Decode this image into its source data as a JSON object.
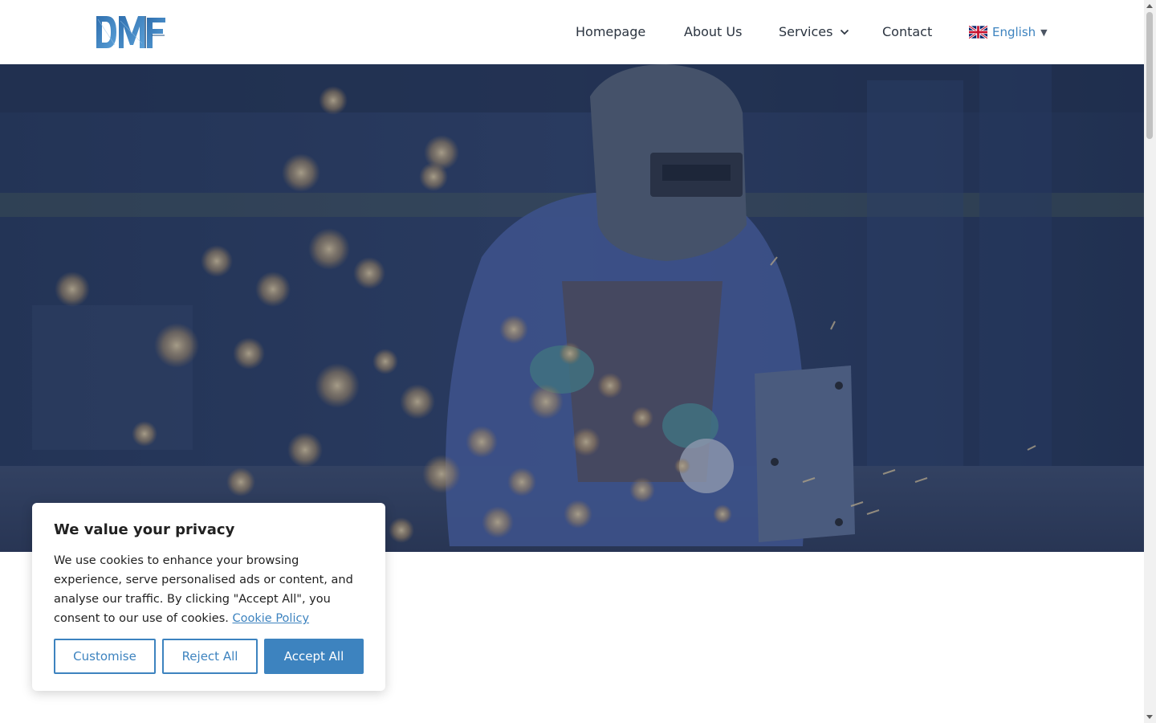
{
  "header": {
    "logo_alt": "DMF",
    "nav": [
      {
        "label": "Homepage"
      },
      {
        "label": "About Us"
      },
      {
        "label": "Services"
      },
      {
        "label": "Contact"
      }
    ],
    "language": {
      "label": "English",
      "flag": "uk-flag-icon"
    }
  },
  "hero": {
    "image": "welder-grinding-sparks",
    "overlay_color": "#243a63"
  },
  "cookie_banner": {
    "title": "We value your privacy",
    "text": "We use cookies to enhance your browsing experience, serve personalised ads or content, and analyse our traffic. By clicking \"Accept All\", you consent to our use of cookies.",
    "policy_link": "Cookie Policy",
    "buttons": {
      "customise": "Customise",
      "reject": "Reject All",
      "accept": "Accept All"
    }
  },
  "colors": {
    "accent": "#3d83bf",
    "nav_text": "#2b3440"
  }
}
